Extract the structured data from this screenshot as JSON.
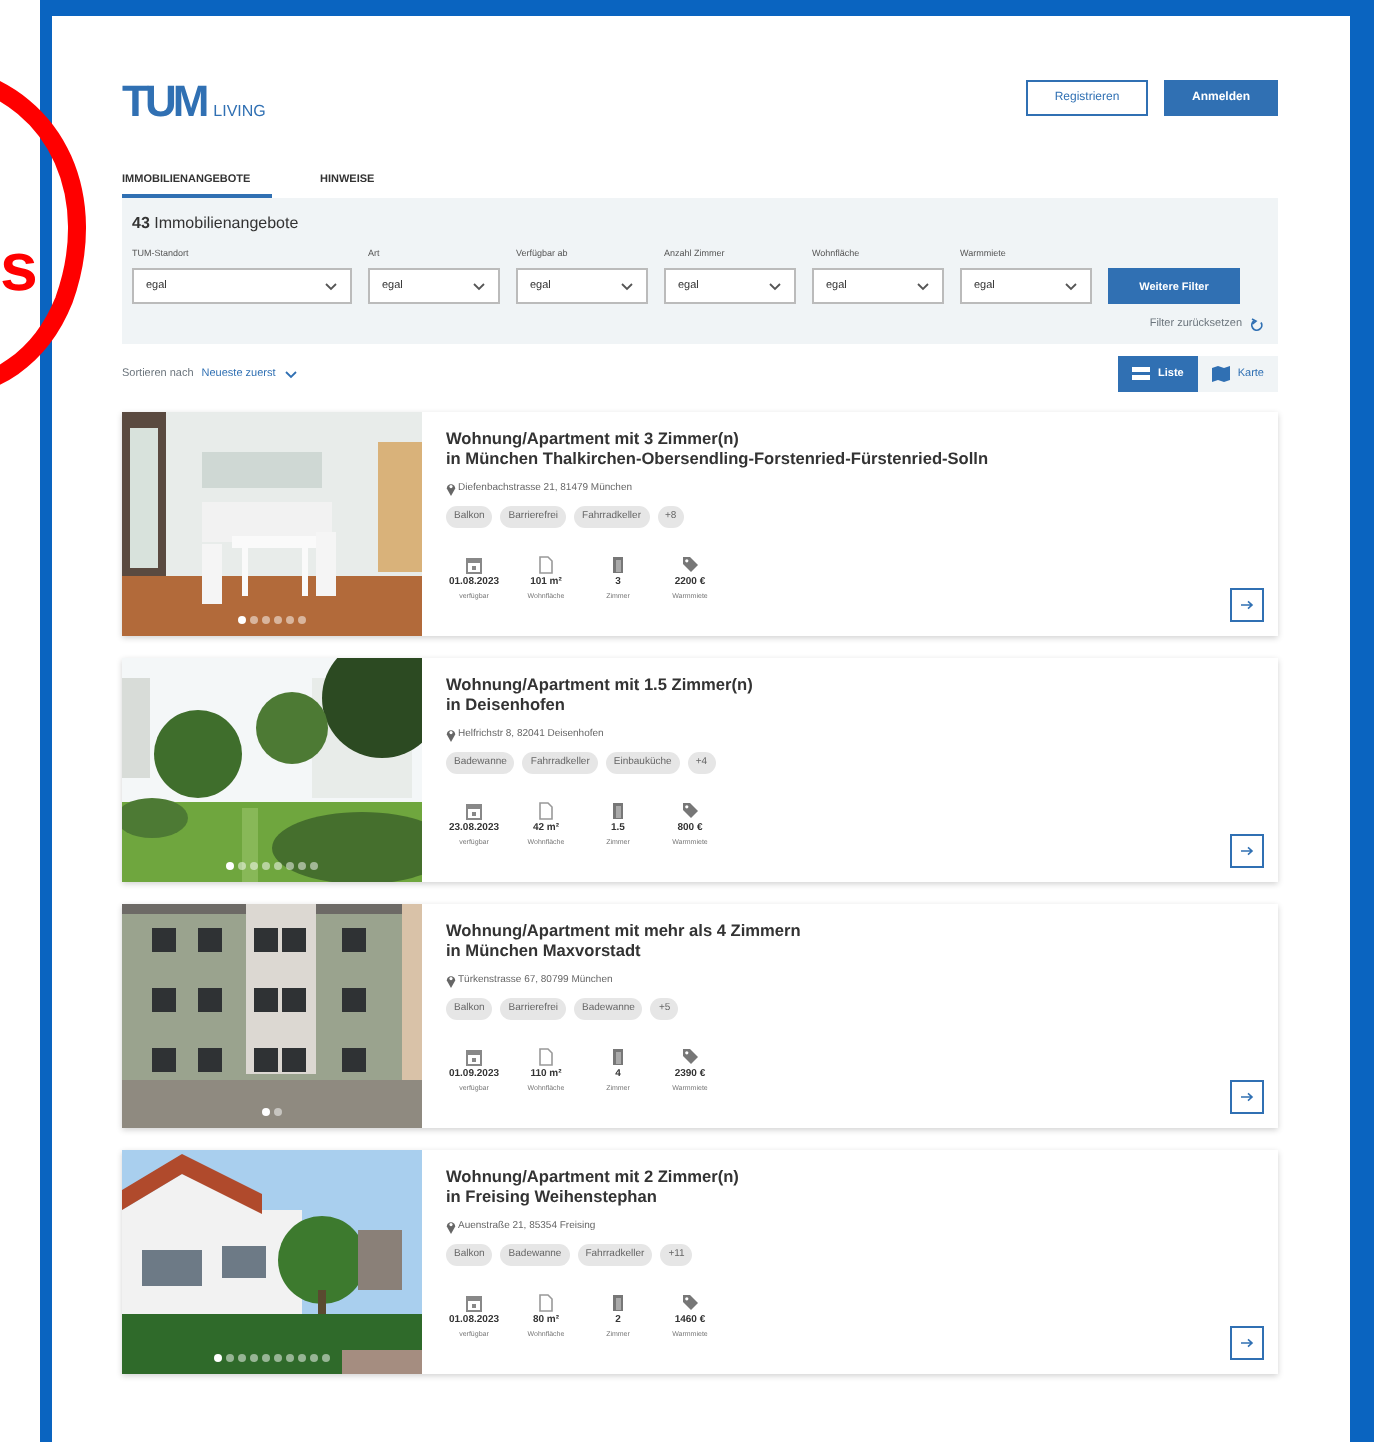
{
  "annotation": {
    "text": "s"
  },
  "header": {
    "logo_mark": "TUM",
    "logo_text": "LIVING",
    "buttons": [
      {
        "label": "Registrieren",
        "kind": "outline"
      },
      {
        "label": "Anmelden",
        "kind": "primary"
      }
    ]
  },
  "tabs": [
    {
      "label": "IMMOBILIENANGEBOTE",
      "selected": true
    },
    {
      "label": "HINWEISE",
      "selected": false
    }
  ],
  "filters": {
    "count": "43",
    "heading": "Immobilienangebote",
    "fields": [
      {
        "label": "TUM-Standort",
        "value": "egal"
      },
      {
        "label": "Art",
        "value": "egal"
      },
      {
        "label": "Verfügbar ab",
        "value": "egal"
      },
      {
        "label": "Anzahl Zimmer",
        "value": "egal"
      },
      {
        "label": "Wohnfläche",
        "value": "egal"
      },
      {
        "label": "Warmmiete",
        "value": "egal"
      }
    ],
    "more_button": "Weitere Filter",
    "reset": "Filter zurücksetzen"
  },
  "sort": {
    "label": "Sortieren nach",
    "value": "Neueste zuerst"
  },
  "view_toggle": [
    {
      "label": "Liste",
      "kind": "list",
      "selected": true
    },
    {
      "label": "Karte",
      "kind": "map",
      "selected": false
    }
  ],
  "listings": [
    {
      "title": "Wohnung/Apartment mit 3 Zimmer(n)",
      "location": "in München Thalkirchen-Obersendling-Forstenried-Fürstenried-Solln",
      "address": "Diefenbachstrasse 21, 81479 München",
      "tags": [
        "Balkon",
        "Barrierefrei",
        "Fahrradkeller",
        "+8"
      ],
      "image": {
        "kind": "kitchen",
        "dots": [
          {
            "selected": true
          },
          {
            "selected": false
          },
          {
            "selected": false
          },
          {
            "selected": false
          },
          {
            "selected": false
          },
          {
            "selected": false
          }
        ]
      },
      "stats": [
        {
          "kind": "date",
          "value": "01.08.2023",
          "label": "verfügbar"
        },
        {
          "kind": "area",
          "value": "101 m²",
          "label": "Wohnfläche"
        },
        {
          "kind": "rooms",
          "value": "3",
          "label": "Zimmer"
        },
        {
          "kind": "price",
          "value": "2200 €",
          "label": "Warmmiete"
        }
      ]
    },
    {
      "title": "Wohnung/Apartment mit 1.5 Zimmer(n)",
      "location": "in Deisenhofen",
      "address": "Helfrichstr 8, 82041 Deisenhofen",
      "tags": [
        "Badewanne",
        "Fahrradkeller",
        "Einbauküche",
        "+4"
      ],
      "image": {
        "kind": "garden",
        "dots": [
          {
            "selected": true
          },
          {
            "selected": false
          },
          {
            "selected": false
          },
          {
            "selected": false
          },
          {
            "selected": false
          },
          {
            "selected": false
          },
          {
            "selected": false
          },
          {
            "selected": false
          }
        ]
      },
      "stats": [
        {
          "kind": "date",
          "value": "23.08.2023",
          "label": "verfügbar"
        },
        {
          "kind": "area",
          "value": "42 m²",
          "label": "Wohnfläche"
        },
        {
          "kind": "rooms",
          "value": "1.5",
          "label": "Zimmer"
        },
        {
          "kind": "price",
          "value": "800 €",
          "label": "Warmmiete"
        }
      ]
    },
    {
      "title": "Wohnung/Apartment mit mehr als 4 Zimmern",
      "location": "in München Maxvorstadt",
      "address": "Türkenstrasse 67, 80799 München",
      "tags": [
        "Balkon",
        "Barrierefrei",
        "Badewanne",
        "+5"
      ],
      "image": {
        "kind": "facade",
        "dots": [
          {
            "selected": true
          },
          {
            "selected": false
          }
        ]
      },
      "stats": [
        {
          "kind": "date",
          "value": "01.09.2023",
          "label": "verfügbar"
        },
        {
          "kind": "area",
          "value": "110 m²",
          "label": "Wohnfläche"
        },
        {
          "kind": "rooms",
          "value": "4",
          "label": "Zimmer"
        },
        {
          "kind": "price",
          "value": "2390 €",
          "label": "Warmmiete"
        }
      ]
    },
    {
      "title": "Wohnung/Apartment mit 2 Zimmer(n)",
      "location": "in Freising Weihenstephan",
      "address": "Auenstraße 21, 85354 Freising",
      "tags": [
        "Balkon",
        "Badewanne",
        "Fahrradkeller",
        "+11"
      ],
      "image": {
        "kind": "house",
        "dots": [
          {
            "selected": true
          },
          {
            "selected": false
          },
          {
            "selected": false
          },
          {
            "selected": false
          },
          {
            "selected": false
          },
          {
            "selected": false
          },
          {
            "selected": false
          },
          {
            "selected": false
          },
          {
            "selected": false
          },
          {
            "selected": false
          }
        ]
      },
      "stats": [
        {
          "kind": "date",
          "value": "01.08.2023",
          "label": "verfügbar"
        },
        {
          "kind": "area",
          "value": "80 m²",
          "label": "Wohnfläche"
        },
        {
          "kind": "rooms",
          "value": "2",
          "label": "Zimmer"
        },
        {
          "kind": "price",
          "value": "1460 €",
          "label": "Warmmiete"
        }
      ]
    }
  ]
}
